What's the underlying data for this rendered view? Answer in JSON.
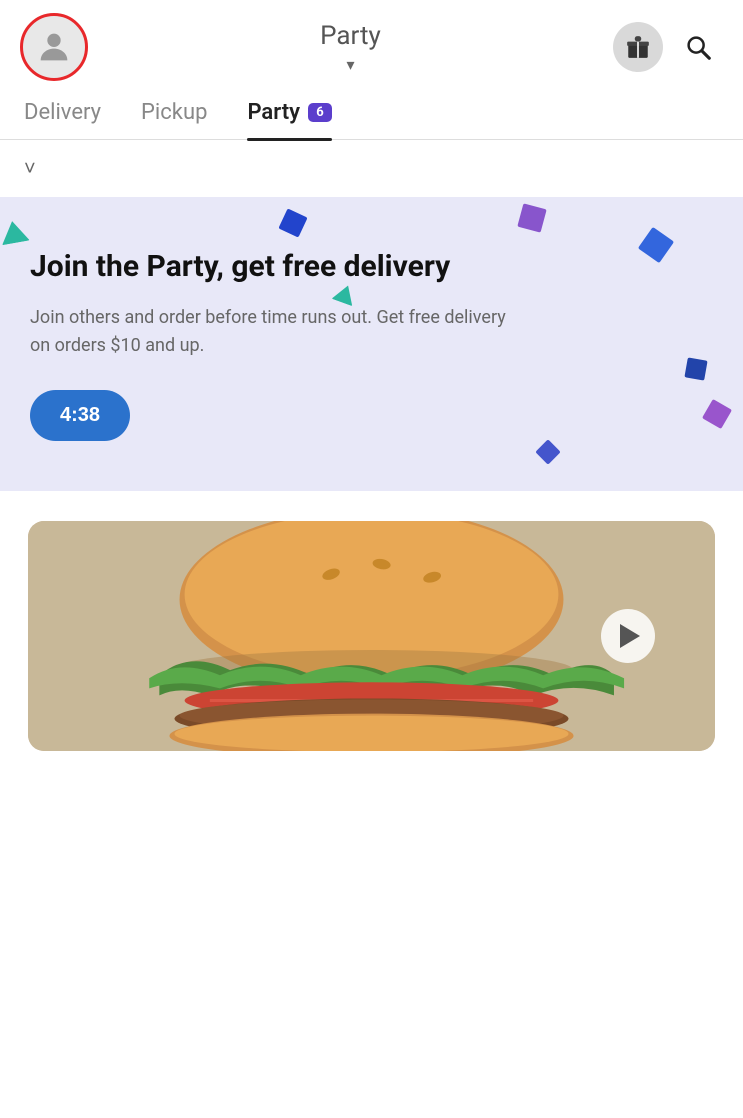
{
  "header": {
    "title": "Party",
    "chevron": "▾",
    "avatar_label": "User avatar",
    "gift_label": "Rewards",
    "search_label": "Search"
  },
  "tabs": {
    "items": [
      {
        "id": "delivery",
        "label": "Delivery",
        "active": false,
        "badge": null
      },
      {
        "id": "pickup",
        "label": "Pickup",
        "active": false,
        "badge": null
      },
      {
        "id": "party",
        "label": "Party",
        "active": true,
        "badge": "6"
      }
    ]
  },
  "sub_header": {
    "chevron": "˅"
  },
  "banner": {
    "title": "Join the Party, get free delivery",
    "description": "Join others and order before time runs out. Get free delivery on orders $10 and up.",
    "timer": "4:38"
  },
  "food_section": {
    "image_alt": "Burger"
  }
}
